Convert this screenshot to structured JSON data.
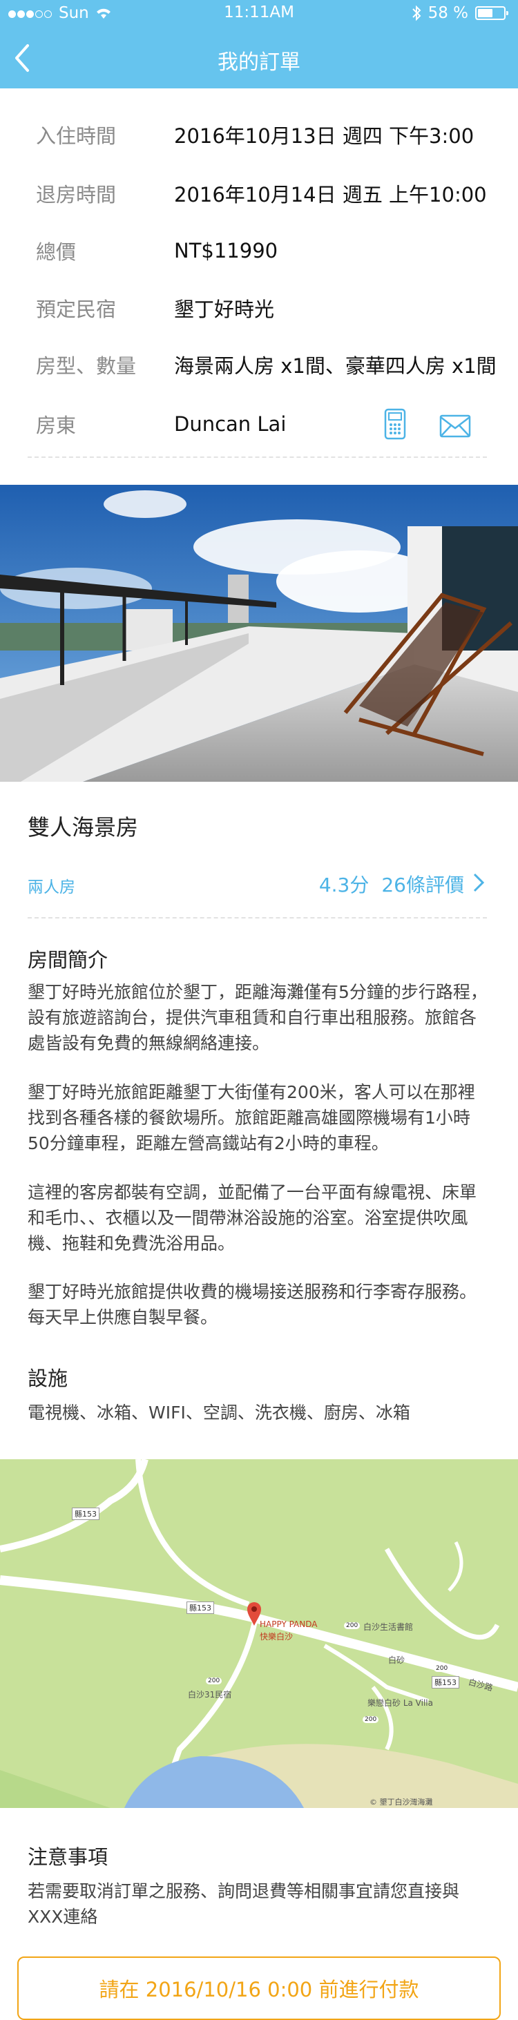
{
  "status_bar": {
    "carrier": "Sun",
    "time": "11:11AM",
    "battery": "58 %",
    "battery_level": 0.58
  },
  "nav": {
    "title": "我的訂單"
  },
  "booking": {
    "check_in_label": "入住時間",
    "check_in": "2016年10月13日 週四 下午3:00",
    "check_out_label": "退房時間",
    "check_out": "2016年10月14日 週五 上午10:00",
    "total_label": "總價",
    "total": "NT$11990",
    "bnb_label": "預定民宿",
    "bnb": "墾丁好時光",
    "rooms_label": "房型、數量",
    "rooms": "海景兩人房 x1間、豪華四人房 x1間",
    "host_label": "房東",
    "host": "Duncan Lai"
  },
  "room": {
    "name": "雙人海景房",
    "capacity": "兩人房",
    "rating": "4.3分",
    "reviews": "26條評價"
  },
  "intro": {
    "title": "房間簡介",
    "p1": "墾丁好時光旅館位於墾丁，距離海灘僅有5分鐘的步行路程，設有旅遊諮詢台，提供汽車租賃和自行車出租服務。旅館各處皆設有免費的無線網絡連接。",
    "p2": "墾丁好時光旅館距離墾丁大街僅有200米，客人可以在那裡找到各種各樣的餐飲場所。旅館距離高雄國際機場有1小時50分鐘車程，距離左營高鐵站有2小時的車程。",
    "p3": "這裡的客房都裝有空調，並配備了一台平面有線電視、床單和毛巾、、衣櫃以及一間帶淋浴設施的浴室。浴室提供吹風機、拖鞋和免費洗浴用品。",
    "p4": "墾丁好時光旅館提供收費的機場接送服務和行李寄存服務。每天早上供應自製早餐。"
  },
  "facilities": {
    "title": "設施",
    "list": "電視機、冰箱、WIFI、空調、洗衣機、廚房、冰箱"
  },
  "map": {
    "road_153a": "縣153",
    "road_153b": "縣153",
    "road_153c": "縣153",
    "pin_name": "HAPPY PANDA",
    "pin_sub": "快樂白沙",
    "r200a": "200",
    "baisha_book": "白沙生活書館",
    "baisha": "白砂",
    "r200b": "200",
    "r200c": "200",
    "r200d": "200",
    "baisha_road": "白沙路",
    "villa": "樂戀白砂 La Villa",
    "baisha31": "白沙31民宿",
    "copyright": "© 墾丁白沙灣海灘"
  },
  "notice": {
    "title": "注意事項",
    "text": "若需要取消訂單之服務、詢問退費等相關事宜請您直接與XXX連絡"
  },
  "pay_button": "請在 2016/10/16 0:00 前進行付款",
  "colors": {
    "primary": "#66c4ee",
    "accent_blue": "#4cb3e6",
    "pay_orange": "#f2a516"
  },
  "icons": [
    "wifi-icon",
    "bluetooth-icon",
    "back-chevron-icon",
    "phone-icon",
    "mail-icon",
    "chevron-right-icon",
    "map-pin-icon"
  ]
}
